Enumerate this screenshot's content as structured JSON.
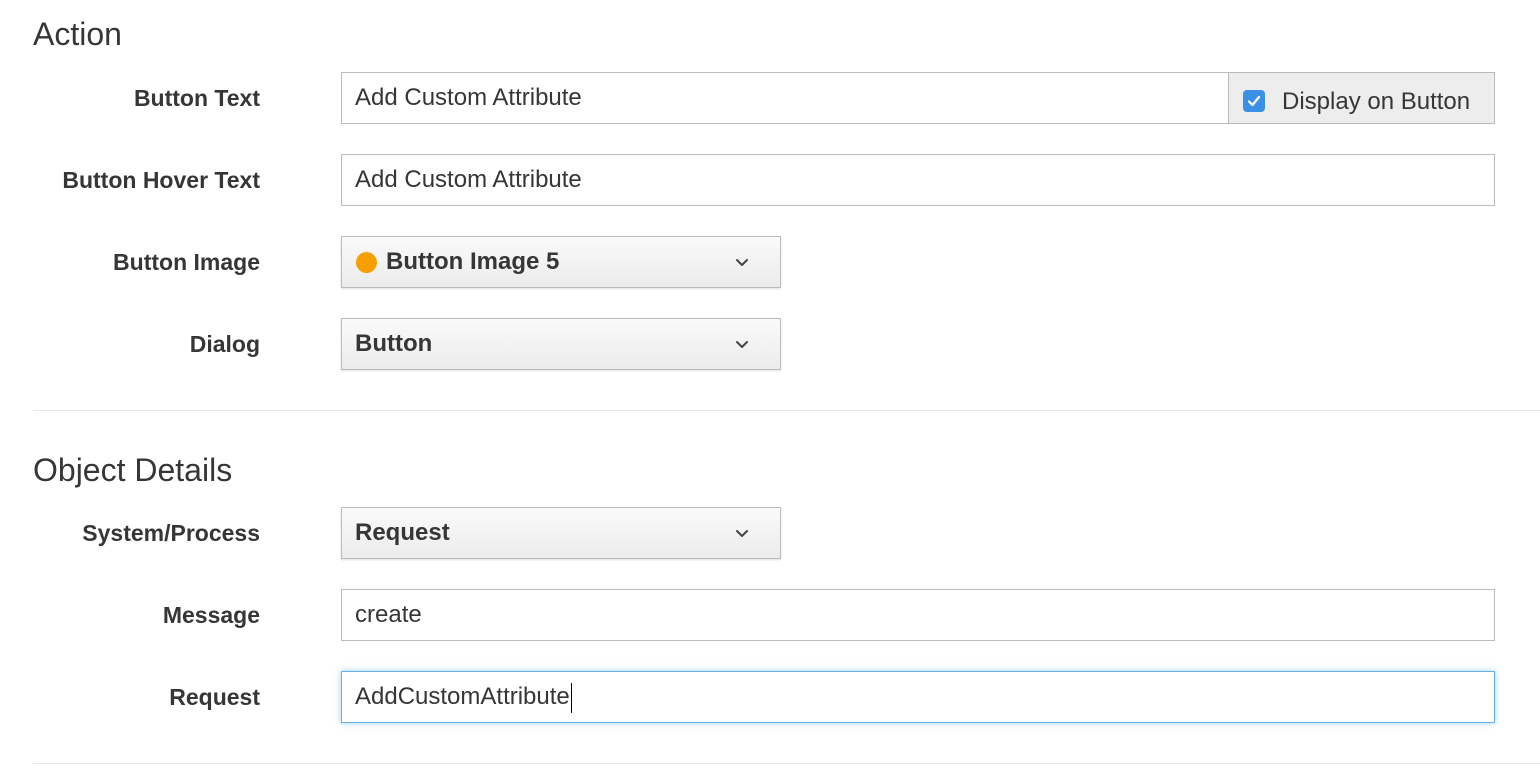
{
  "action_section": {
    "title": "Action",
    "button_text": {
      "label": "Button Text",
      "value": "Add Custom Attribute",
      "display_on_button": {
        "label": "Display on Button",
        "checked": true
      }
    },
    "button_hover_text": {
      "label": "Button Hover Text",
      "value": "Add Custom Attribute"
    },
    "button_image": {
      "label": "Button Image",
      "selected": "Button Image 5",
      "dot_color": "#f5a000"
    },
    "dialog": {
      "label": "Dialog",
      "selected": "Button"
    }
  },
  "object_details_section": {
    "title": "Object Details",
    "system_process": {
      "label": "System/Process",
      "selected": "Request"
    },
    "message": {
      "label": "Message",
      "value": "create"
    },
    "request": {
      "label": "Request",
      "value": "AddCustomAttribute",
      "focused": true
    }
  },
  "colors": {
    "accent": "#3b8fe5",
    "focus_border": "#66afe9"
  }
}
